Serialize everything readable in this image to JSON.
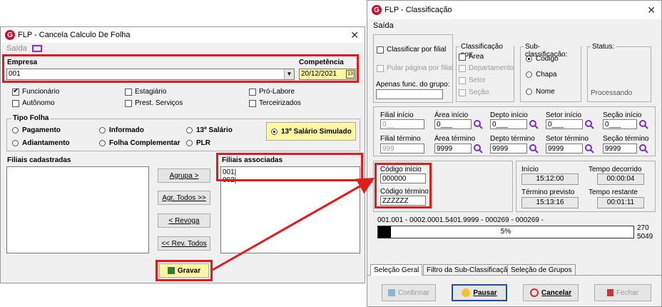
{
  "left_window": {
    "title": "FLP - Cancela Calculo De Folha",
    "menu_saida": "Saída",
    "empresa_label": "Empresa",
    "empresa_value": "001",
    "competencia_label": "Competência",
    "competencia_value": "20/12/2021",
    "checkboxes": [
      {
        "label": "Funcionário",
        "checked": true
      },
      {
        "label": "Estagiário",
        "checked": false
      },
      {
        "label": "Pró-Labore",
        "checked": false
      },
      {
        "label": "Autônomo",
        "checked": false
      },
      {
        "label": "Prest. Serviços",
        "checked": false
      },
      {
        "label": "Terceirizados",
        "checked": false
      }
    ],
    "tipo_folha_label": "Tipo Folha",
    "tipo_folha_options": [
      "Pagamento",
      "Informado",
      "13º Salário",
      "Adiantamento",
      "Folha Complementar",
      "PLR"
    ],
    "salario_simulado_label": "13º Salário Simulado",
    "filiais_cadastradas_label": "Filiais cadastradas",
    "filiais_associadas_label": "Filiais associadas",
    "filiais_associadas_items": [
      "001|",
      "002|"
    ],
    "btn_agrupa": "Agrupa >",
    "btn_agr_todos": "Agr. Todos >>",
    "btn_revoga": "< Revoga",
    "btn_rev_todos": "<< Rev. Todos",
    "btn_gravar": "Gravar"
  },
  "right_window": {
    "title": "FLP - Classificação",
    "menu_saida": "Saída",
    "classificar_por_filial": "Classificar por filial",
    "pular_pagina": "Pular página por filial",
    "apenas_func_label": "Apenas func. do grupo:",
    "classificacao_por_label": "Classificação  por:",
    "classificacao_options": [
      "Área",
      "Departamento",
      "Setor",
      "Seção"
    ],
    "sub_classificacao_label": "Sub-classificação:",
    "sub_options": [
      "Codigo",
      "Chapa",
      "Nome"
    ],
    "status_label": "Status:",
    "status_value": "Processando",
    "filial_inicio_label": "Filial início",
    "filial_inicio_value": "0__",
    "filial_termino_label": "Filial término",
    "filial_termino_value": "999",
    "area_inicio_label": "Área início",
    "area_inicio_value": "0___",
    "area_termino_label": "Área término",
    "area_termino_value": "9999",
    "depto_inicio_label": "Depto início",
    "depto_inicio_value": "0___",
    "depto_termino_label": "Depto término",
    "depto_termino_value": "9999",
    "setor_inicio_label": "Setor início",
    "setor_inicio_value": "0___",
    "setor_termino_label": "Setor término",
    "setor_termino_value": "9999",
    "secao_inicio_label": "Seção início",
    "secao_inicio_value": "0___",
    "secao_termino_label": "Seção término",
    "secao_termino_value": "9999",
    "codigo_inicio_label": "Código início",
    "codigo_inicio_value": "000000",
    "codigo_termino_label": "Código término",
    "codigo_termino_value": "ZZZZZZ",
    "inicio_label": "Início",
    "inicio_value": "15:12:00",
    "tempo_decorrido_label": "Tempo decorrido",
    "tempo_decorrido_value": "00:00:04",
    "termino_previsto_label": "Término previsto",
    "termino_previsto_value": "15:13:16",
    "tempo_restante_label": "Tempo restante",
    "tempo_restante_value": "00:01:11",
    "progress_path": "001.001 - 0002.0001.5401.9999 - 000269 - 000269 -",
    "progress_percent_label": "5%",
    "progress_fraction": 0.05,
    "progress_count_top": "270",
    "progress_count_bottom": "5049",
    "tabs": [
      "Seleção Geral",
      "Filtro da Sub-Classificação",
      "Seleção de Grupos"
    ],
    "btn_confirmar": "Confirmar",
    "btn_pausar": "Pausar",
    "btn_cancelar": "Cancelar",
    "btn_fechar": "Fechar"
  },
  "colors": {
    "annotation_red": "#e21b1b",
    "highlight_yellow": "#fdf6a3",
    "progress_black": "#000000"
  }
}
